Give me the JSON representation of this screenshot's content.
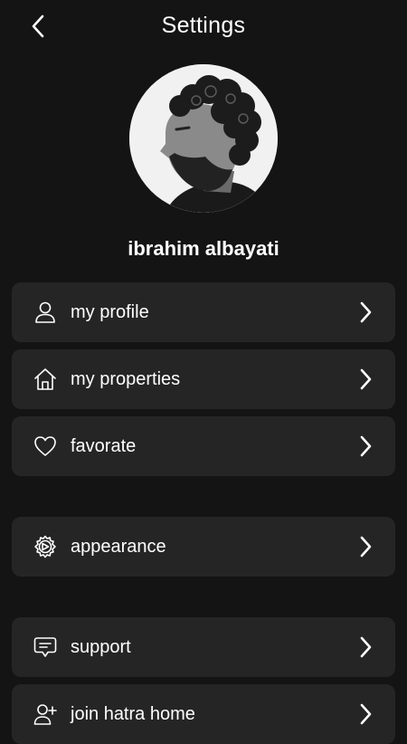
{
  "header": {
    "title": "Settings",
    "back_icon": "chevron-left-icon"
  },
  "profile": {
    "name": "ibrahim albayati",
    "avatar": "profile-photo"
  },
  "menu": [
    {
      "label": "my profile",
      "icon": "user-icon"
    },
    {
      "label": "my properties",
      "icon": "home-icon"
    },
    {
      "label": "favorate",
      "icon": "heart-icon"
    },
    {
      "label": "appearance",
      "icon": "gear-icon"
    },
    {
      "label": "support",
      "icon": "chat-icon"
    },
    {
      "label": "join hatra home",
      "icon": "add-user-icon"
    }
  ],
  "colors": {
    "background": "#141414",
    "card": "#252525",
    "text": "#ffffff"
  }
}
